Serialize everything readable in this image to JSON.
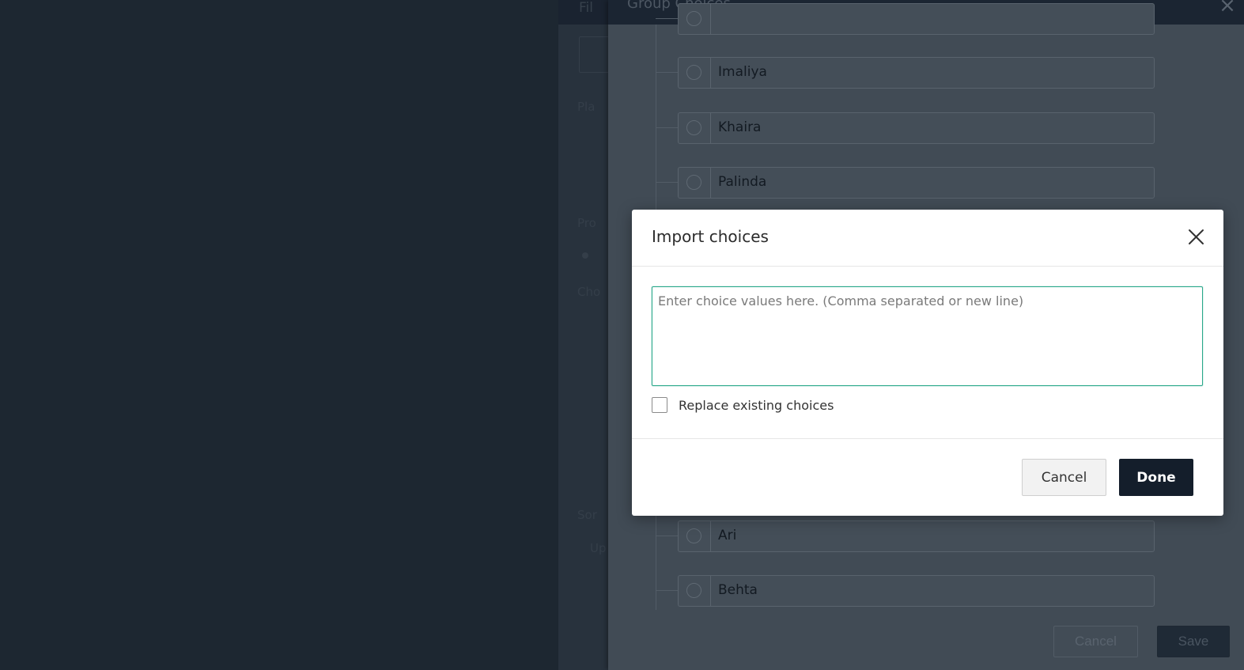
{
  "background_panel": {
    "header_text": "Fil",
    "ghost_labels": [
      "Pla",
      "Pro",
      "Cho",
      "Sor",
      "Up"
    ]
  },
  "drawer": {
    "title": "Group Choices",
    "close_symbol": "×",
    "choices": [
      {
        "label": ""
      },
      {
        "label": "Imaliya"
      },
      {
        "label": "Khaira"
      },
      {
        "label": "Palinda"
      },
      {
        "label": "Ari"
      },
      {
        "label": "Behta"
      }
    ],
    "cancel_label": "Cancel",
    "save_label": "Save"
  },
  "modal": {
    "title": "Import choices",
    "textarea_placeholder": "Enter choice values here. (Comma separated or new line)",
    "textarea_value": "",
    "checkbox_label": "Replace existing choices",
    "checkbox_checked": false,
    "cancel_label": "Cancel",
    "done_label": "Done"
  },
  "colors": {
    "accent_focus": "#2aa88a",
    "primary_button": "#141e2b",
    "overlay_dark": "#1d2731"
  }
}
